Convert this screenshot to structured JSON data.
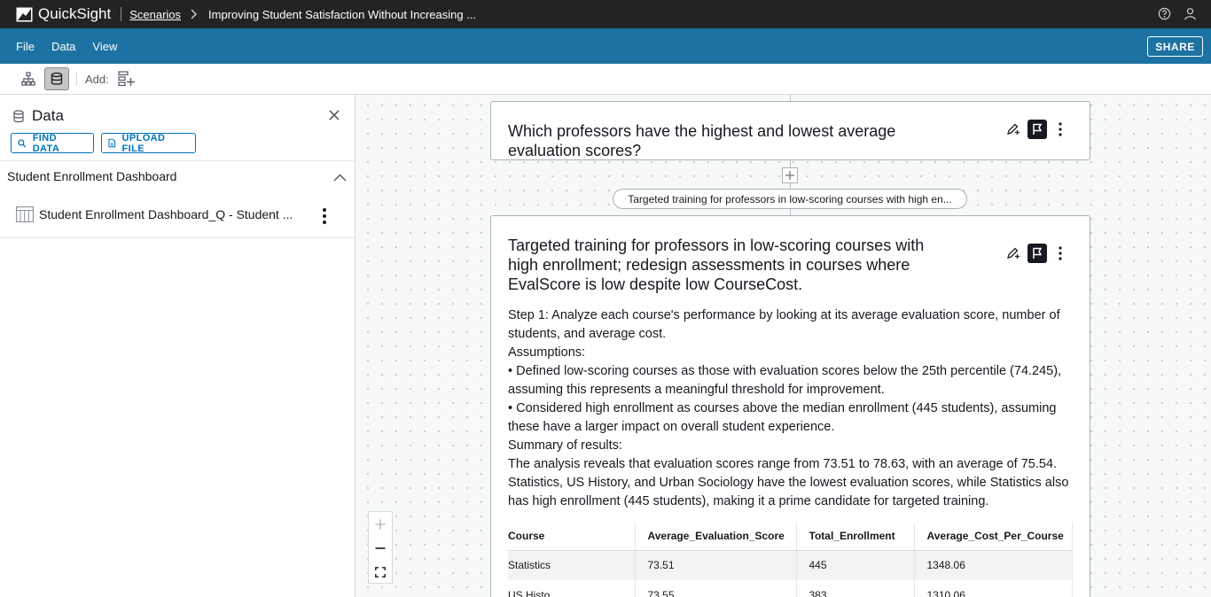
{
  "app": {
    "name": "QuickSight",
    "breadcrumb_link": "Scenarios",
    "breadcrumb_title": "Improving Student Satisfaction Without Increasing ..."
  },
  "menu": {
    "file": "File",
    "data": "Data",
    "view": "View",
    "share": "SHARE"
  },
  "toolbar": {
    "add_label": "Add:"
  },
  "panel": {
    "title": "Data",
    "find_data": "FIND DATA",
    "upload_file": "UPLOAD FILE",
    "dataset_group": "Student Enrollment Dashboard",
    "dataset_item": "Student Enrollment Dashboard_Q - Student ..."
  },
  "canvas": {
    "card1_title": "Which professors have the highest and lowest average evaluation scores?",
    "pill_label": "Targeted training for professors in low-scoring courses with high en...",
    "card2_title": "Targeted training for professors in low-scoring courses with high enrollment; redesign assessments in courses where EvalScore is low despite low CourseCost.",
    "step1": "Step 1: Analyze each course's performance by looking at its average evaluation score, number of students, and average cost.",
    "assumptions_label": "Assumptions:",
    "assumption1": "• Defined low-scoring courses as those with evaluation scores below the 25th percentile (74.245), assuming this represents a meaningful threshold for improvement.",
    "assumption2": "• Considered high enrollment as courses above the median enrollment (445 students), assuming these have a larger impact on overall student experience.",
    "summary_label": "Summary of results:",
    "summary1": "The analysis reveals that evaluation scores range from 73.51 to 78.63, with an average of 75.54.",
    "summary2": "Statistics, US History, and Urban Sociology have the lowest evaluation scores, while Statistics also has high enrollment (445 students), making it a prime candidate for targeted training.",
    "table": {
      "headers": [
        "Course",
        "Average_Evaluation_Score",
        "Total_Enrollment",
        "Average_Cost_Per_Course"
      ],
      "rows": [
        [
          "Statistics",
          "73.51",
          "445",
          "1348.06"
        ],
        [
          "US Histo",
          "73.55",
          "383",
          "1310.06"
        ]
      ]
    }
  },
  "colors": {
    "topbar": "#232323",
    "menubar": "#1c72a2",
    "link": "#0073bb"
  },
  "icons": [
    "quicksight-logo-icon",
    "chevron-right-icon",
    "help-icon",
    "user-icon",
    "hierarchy-icon",
    "database-icon",
    "add-visual-icon",
    "close-icon",
    "search-icon",
    "file-icon",
    "chevron-up-icon",
    "table-icon",
    "more-vertical-icon",
    "edit-ai-icon",
    "flag-icon",
    "plus-icon",
    "minus-icon",
    "fit-screen-icon"
  ]
}
